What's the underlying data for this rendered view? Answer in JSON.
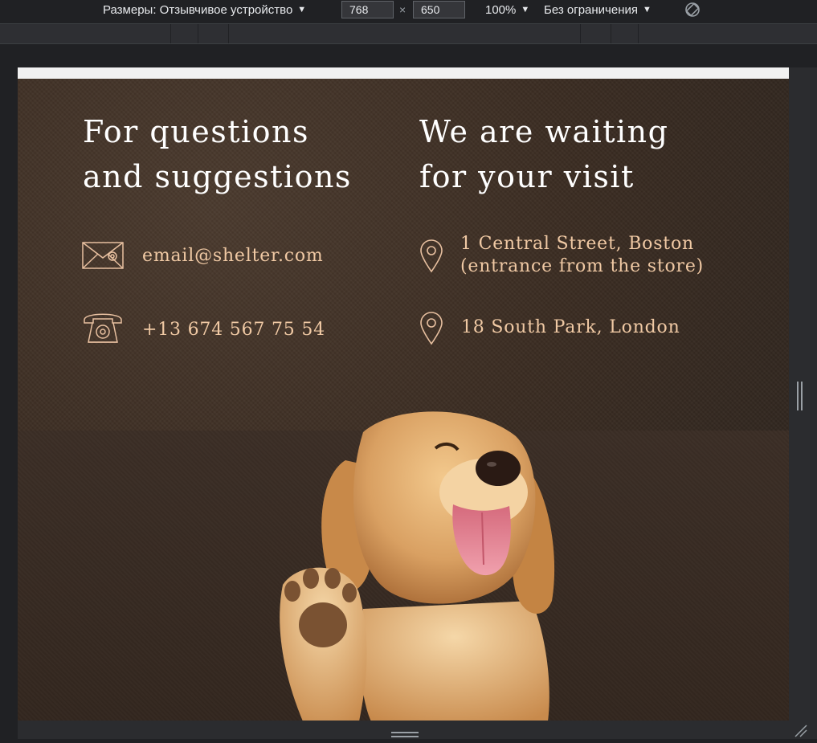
{
  "devtools": {
    "dimensions_label": "Размеры: Отзывчивое устройство",
    "width_value": "768",
    "times_sign": "×",
    "height_value": "650",
    "zoom_label": "100%",
    "throttle_label": "Без ограничения",
    "dropdown_icon": "caret-down-icon",
    "rotate_icon": "rotate-icon"
  },
  "page": {
    "left_heading_line1": "For questions",
    "left_heading_line2": "and suggestions",
    "right_heading_line1": "We are waiting",
    "right_heading_line2": "for your visit",
    "contacts": {
      "email": "email@shelter.com",
      "phone": "+13 674 567 75 54",
      "address1_line1": "1 Central Street, Boston",
      "address1_line2": "(entrance from the store)",
      "address2": "18 South Park, London"
    },
    "icons": [
      "envelope-icon",
      "phone-icon",
      "location-pin-icon",
      "location-pin-icon"
    ],
    "image": "puppy-waving-image",
    "colors": {
      "heading": "#ffffff",
      "contact_text": "#f0c9a4",
      "icon_stroke": "#e8c0a0",
      "background": "#3a2c22"
    }
  }
}
